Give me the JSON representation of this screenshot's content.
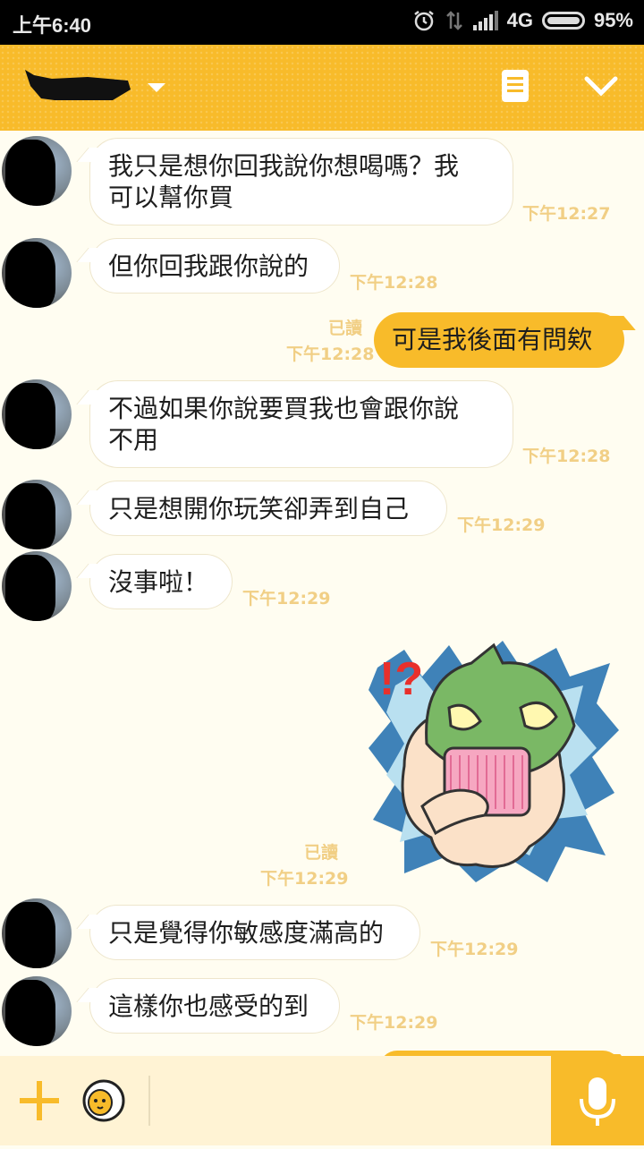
{
  "status_bar": {
    "time": "上午6:40",
    "network": "4G",
    "battery": "95%"
  },
  "header": {
    "contact_name": "",
    "menu_icon": "notes-icon",
    "collapse_icon": "chevron-down-icon"
  },
  "messages": [
    {
      "side": "in",
      "text": "我只是想你回我說你想喝嗎？我\n可以幫你買",
      "time": "下午12:27"
    },
    {
      "side": "in",
      "text": "但你回我跟你說的",
      "time": "下午12:28"
    },
    {
      "side": "out",
      "text": "可是我後面有問欸",
      "time": "下午12:28",
      "read": "已讀"
    },
    {
      "side": "in",
      "text": "不過如果你說要買我也會跟你說\n不用",
      "time": "下午12:28"
    },
    {
      "side": "in",
      "text": "只是想開你玩笑卻弄到自己",
      "time": "下午12:29"
    },
    {
      "side": "in",
      "text": "沒事啦！",
      "time": "下午12:29"
    },
    {
      "side": "out",
      "type": "sticker",
      "sticker": "surprised-green-hat-character",
      "time": "下午12:29",
      "read": "已讀"
    },
    {
      "side": "in",
      "text": "只是覺得你敏感度滿高的",
      "time": "下午12:29"
    },
    {
      "side": "in",
      "text": "這樣你也感受的到",
      "time": "下午12:29"
    }
  ],
  "input_bar": {
    "placeholder": "",
    "plus_icon": "plus-icon",
    "emoji_icon": "emoji-icon",
    "mic_icon": "microphone-icon"
  },
  "colors": {
    "accent": "#f8bb2a",
    "background": "#fffdf1",
    "timestamp": "#f1cf85"
  }
}
